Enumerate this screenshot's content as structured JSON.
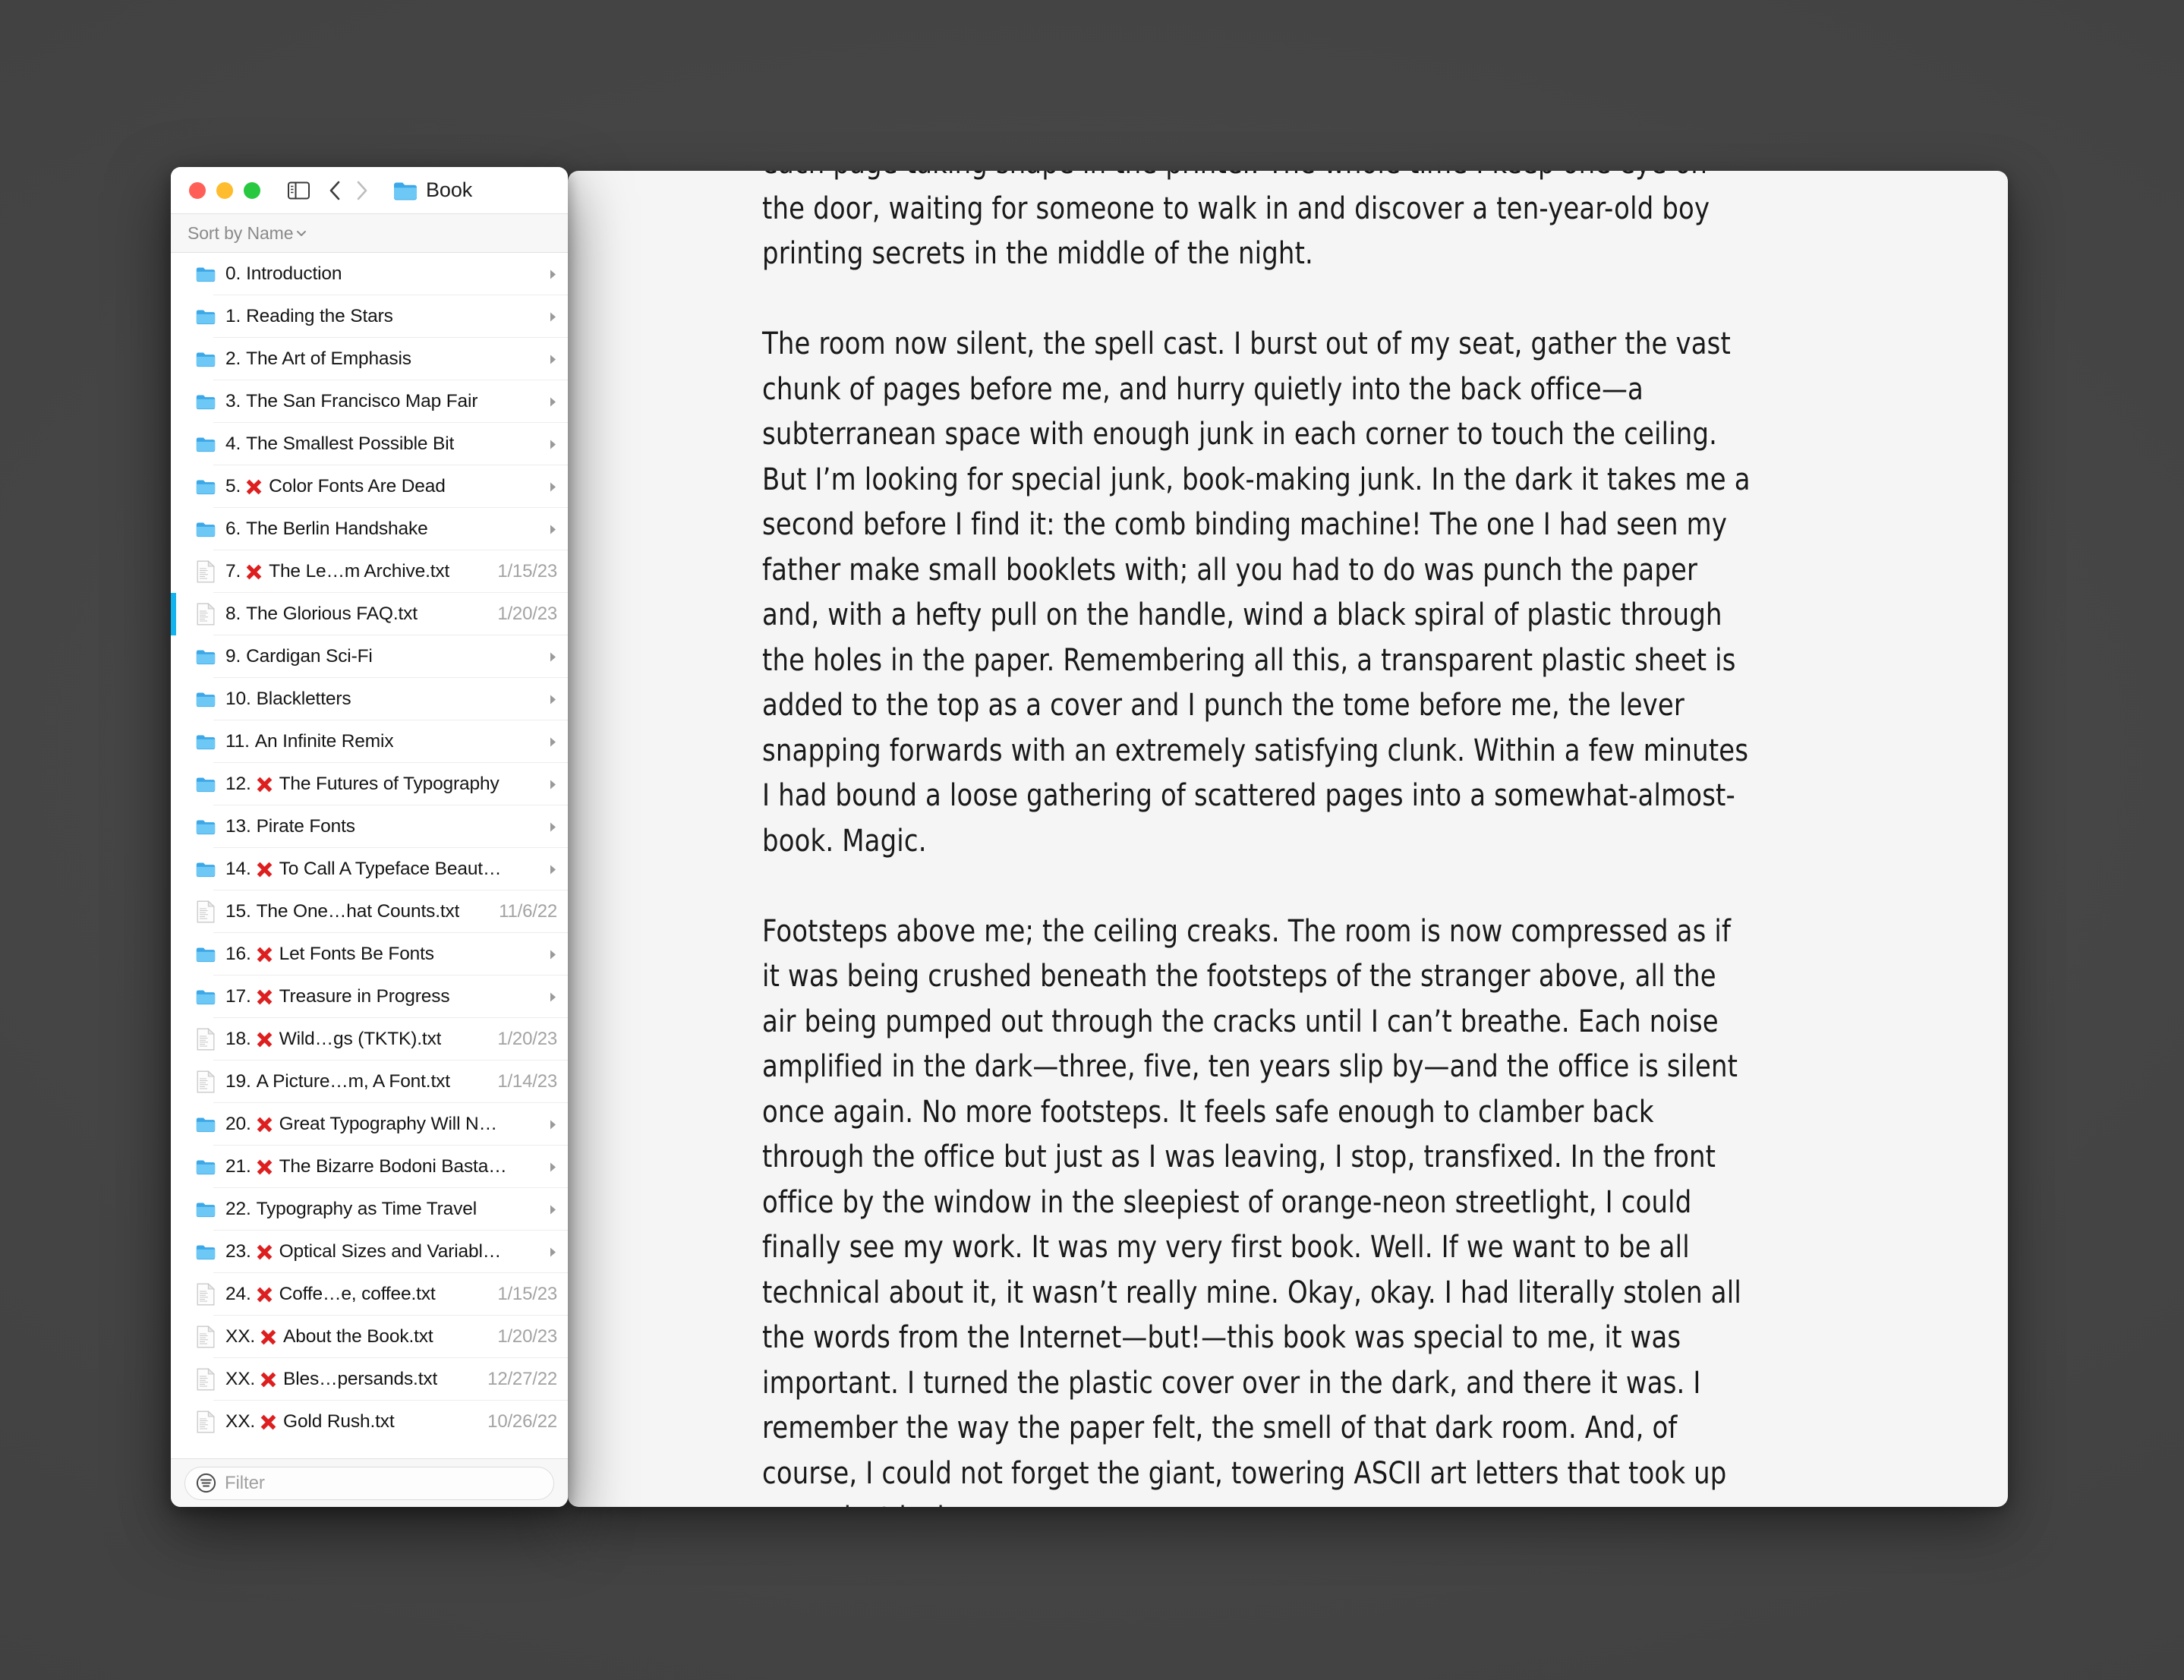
{
  "window": {
    "title": "Book",
    "traffic_lights": [
      "close",
      "minimize",
      "maximize"
    ],
    "sort_label": "Sort by Name"
  },
  "filter": {
    "placeholder": "Filter"
  },
  "colors": {
    "close": "#ff5f57",
    "minimize": "#febc2e",
    "maximize": "#28c840",
    "selection_bar": "#12b4ef",
    "folder": "#56b9f0",
    "x_mark": "#e02020",
    "desktop": "#434343",
    "doc_bg": "#f5f5f5",
    "sidebar_bg": "#ffffff"
  },
  "files": [
    {
      "num": "0.",
      "x": false,
      "text": "Introduction",
      "type": "folder",
      "date": "",
      "selected": false
    },
    {
      "num": "1.",
      "x": false,
      "text": "Reading the Stars",
      "type": "folder",
      "date": "",
      "selected": false
    },
    {
      "num": "2.",
      "x": false,
      "text": "The Art of Emphasis",
      "type": "folder",
      "date": "",
      "selected": false
    },
    {
      "num": "3.",
      "x": false,
      "text": "The San Francisco Map Fair",
      "type": "folder",
      "date": "",
      "selected": false
    },
    {
      "num": "4.",
      "x": false,
      "text": "The Smallest Possible Bit",
      "type": "folder",
      "date": "",
      "selected": false
    },
    {
      "num": "5.",
      "x": true,
      "text": "Color Fonts Are Dead",
      "type": "folder",
      "date": "",
      "selected": false
    },
    {
      "num": "6.",
      "x": false,
      "text": "The Berlin Handshake",
      "type": "folder",
      "date": "",
      "selected": false
    },
    {
      "num": "7.",
      "x": true,
      "text": "The Le…m Archive.txt",
      "type": "file",
      "date": "1/15/23",
      "selected": false
    },
    {
      "num": "8.",
      "x": false,
      "text": "The Glorious FAQ.txt",
      "type": "file",
      "date": "1/20/23",
      "selected": true
    },
    {
      "num": "9.",
      "x": false,
      "text": "Cardigan Sci-Fi",
      "type": "folder",
      "date": "",
      "selected": false
    },
    {
      "num": "10.",
      "x": false,
      "text": "Blackletters",
      "type": "folder",
      "date": "",
      "selected": false
    },
    {
      "num": "11.",
      "x": false,
      "text": "An Infinite Remix",
      "type": "folder",
      "date": "",
      "selected": false
    },
    {
      "num": "12.",
      "x": true,
      "text": "The Futures of Typography",
      "type": "folder",
      "date": "",
      "selected": false
    },
    {
      "num": "13.",
      "x": false,
      "text": "Pirate Fonts",
      "type": "folder",
      "date": "",
      "selected": false
    },
    {
      "num": "14.",
      "x": true,
      "text": "To Call A Typeface Beaut…",
      "type": "folder",
      "date": "",
      "selected": false
    },
    {
      "num": "15.",
      "x": false,
      "text": "The One…hat Counts.txt",
      "type": "file",
      "date": "11/6/22",
      "selected": false
    },
    {
      "num": "16.",
      "x": true,
      "text": "Let Fonts Be Fonts",
      "type": "folder",
      "date": "",
      "selected": false
    },
    {
      "num": "17.",
      "x": true,
      "text": "Treasure in Progress",
      "type": "folder",
      "date": "",
      "selected": false
    },
    {
      "num": "18.",
      "x": true,
      "text": "Wild…gs (TKTK).txt",
      "type": "file",
      "date": "1/20/23",
      "selected": false
    },
    {
      "num": "19.",
      "x": false,
      "text": "A Picture…m, A Font.txt",
      "type": "file",
      "date": "1/14/23",
      "selected": false
    },
    {
      "num": "20.",
      "x": true,
      "text": "Great Typography Will N…",
      "type": "folder",
      "date": "",
      "selected": false
    },
    {
      "num": "21.",
      "x": true,
      "text": "The Bizarre Bodoni Basta…",
      "type": "folder",
      "date": "",
      "selected": false
    },
    {
      "num": "22.",
      "x": false,
      "text": "Typography as Time Travel",
      "type": "folder",
      "date": "",
      "selected": false
    },
    {
      "num": "23.",
      "x": true,
      "text": "Optical Sizes and Variabl…",
      "type": "folder",
      "date": "",
      "selected": false
    },
    {
      "num": "24.",
      "x": true,
      "text": "Coffe…e, coffee.txt",
      "type": "file",
      "date": "1/15/23",
      "selected": false
    },
    {
      "num": "XX.",
      "x": true,
      "text": "About the Book.txt",
      "type": "file",
      "date": "1/20/23",
      "selected": false
    },
    {
      "num": "XX.",
      "x": true,
      "text": "Bles…persands.txt",
      "type": "file",
      "date": "12/27/22",
      "selected": false
    },
    {
      "num": "XX.",
      "x": true,
      "text": "Gold Rush.txt",
      "type": "file",
      "date": "10/26/22",
      "selected": false
    }
  ],
  "document": {
    "paragraphs": [
      "each page taking shape in the printer. The whole time I keep one eye on the door, waiting for someone to walk in and discover a ten-year-old boy printing secrets in the middle of the night.",
      "The room now silent, the spell cast. I burst out of my seat, gather the vast chunk of pages before me, and hurry quietly into the back office—a subterranean space with enough junk in each corner to touch the ceiling. But I’m looking for special junk, book-making junk. In the dark it takes me a second before I find it: the comb binding machine! The one I had seen my father make small booklets with; all you had to do was punch the paper and, with a hefty pull on the handle, wind a black spiral of plastic through the holes in the paper. Remembering all this, a transparent plastic sheet is added to the top as a cover and I punch the tome before me, the lever snapping forwards with an extremely satisfying clunk. Within a few minutes I had bound a loose gathering of scattered pages into a somewhat-almost-book. Magic.",
      "Footsteps above me; the ceiling creaks. The room is now compressed as if it was being crushed beneath the footsteps of the stranger above, all the air being pumped out through the cracks until I can’t breathe. Each noise amplified in the dark—three, five, ten years slip by—and the office is silent once again. No more footsteps. It feels safe enough to clamber back through the office but just as I was leaving, I stop, transfixed. In the front office by the window in the sleepiest of orange-neon streetlight, I could finally see my work. It was my very first book. Well. If we want to be all technical about it, it wasn’t really mine. Okay, okay. I had literally stolen all the words from the Internet—but!—this book was special to me, it was important. I turned the plastic cover over in the dark, and there it was. I remember the way the paper felt, the smell of that dark room. And, of course, I could not forget the giant, towering ASCII art letters that took up every last inch"
    ]
  }
}
